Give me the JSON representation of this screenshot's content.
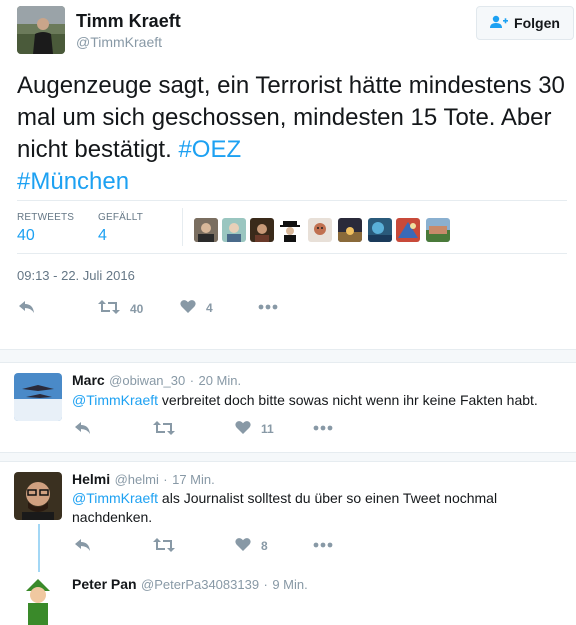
{
  "main_tweet": {
    "name": "Timm Kraeft",
    "handle": "@TimmKraeft",
    "follow_label": "Folgen",
    "text_plain": "Augenzeuge sagt, ein Terrorist hätte mindestens 30 mal um sich geschossen, mindesten 15 Tote. Aber nicht bestätigt. ",
    "hashtag1": "#OEZ",
    "hashtag2": "#München",
    "stats": {
      "retweets_label": "RETWEETS",
      "retweets_value": "40",
      "likes_label": "GEFÄLLT",
      "likes_value": "4"
    },
    "timestamp": "09:13 - 22. Juli 2016",
    "actions": {
      "retweet_count": "40",
      "like_count": "4"
    }
  },
  "replies": [
    {
      "name": "Marc",
      "handle": "@obiwan_30",
      "time": "20 Min.",
      "mention": "@TimmKraeft",
      "text": " verbreitet doch bitte sowas nicht wenn ihr keine Fakten habt.",
      "like_count": "11"
    },
    {
      "name": "Helmi",
      "handle": "@helmi",
      "time": "17 Min.",
      "mention": "@TimmKraeft",
      "text": " als Journalist solltest du über so einen Tweet nochmal nachdenken.",
      "like_count": "8"
    },
    {
      "name": "Peter Pan",
      "handle": "@PeterPa34083139",
      "time": "9 Min."
    }
  ],
  "icons": {
    "follow": "person-plus-icon",
    "reply": "reply-icon",
    "retweet": "retweet-icon",
    "like": "heart-icon",
    "more": "more-dots-icon"
  },
  "colors": {
    "link": "#1da1f2",
    "muted": "#8899a6",
    "divider": "#e6ecf0"
  }
}
